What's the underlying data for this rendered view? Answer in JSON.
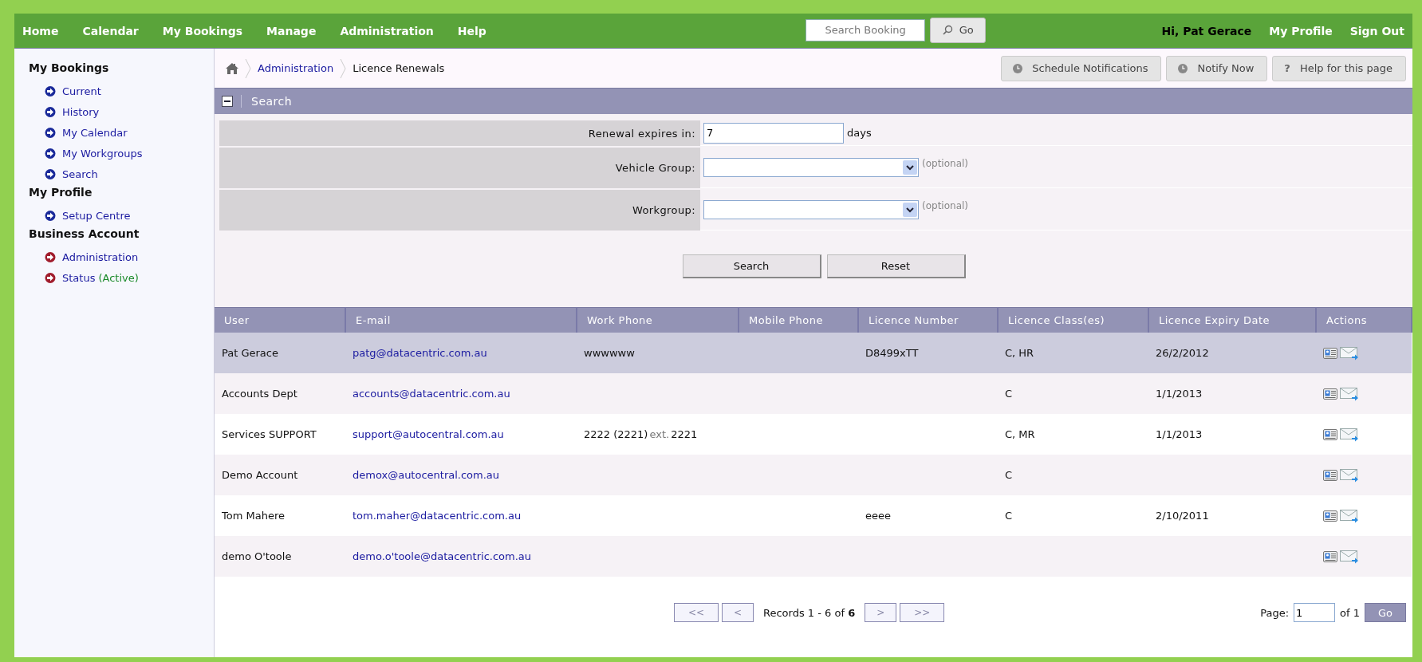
{
  "top_nav": {
    "items": [
      {
        "label": "Home"
      },
      {
        "label": "Calendar"
      },
      {
        "label": "My Bookings"
      },
      {
        "label": "Manage"
      },
      {
        "label": "Administration"
      },
      {
        "label": "Help"
      }
    ],
    "search": {
      "placeholder": "Search Booking",
      "button": "Go"
    },
    "greeting": "Hi, Pat Gerace",
    "links": [
      "My Profile",
      "Sign Out"
    ]
  },
  "sidebar": {
    "sections": [
      {
        "title": "My Bookings",
        "items": [
          {
            "label": "Current",
            "color": "#1a2a9a"
          },
          {
            "label": "History",
            "color": "#1a2a9a"
          },
          {
            "label": "My Calendar",
            "color": "#1a2a9a"
          },
          {
            "label": "My Workgroups",
            "color": "#1a2a9a"
          },
          {
            "label": "Search",
            "color": "#1a2a9a"
          }
        ]
      },
      {
        "title": "My Profile",
        "items": [
          {
            "label": "Setup Centre",
            "color": "#1a2a9a"
          }
        ]
      },
      {
        "title": "Business Account",
        "items": [
          {
            "label": "Administration",
            "color": "#a01c2c"
          },
          {
            "label": "Status",
            "status": "(Active)",
            "color": "#a01c2c"
          }
        ]
      }
    ]
  },
  "breadcrumb": {
    "items": [
      {
        "label": "Administration",
        "link": true
      },
      {
        "label": "Licence Renewals",
        "link": false
      }
    ]
  },
  "toolbar": {
    "buttons": [
      {
        "kind": "clock",
        "label": "Schedule Notifications"
      },
      {
        "kind": "clock",
        "label": "Notify Now"
      },
      {
        "kind": "help",
        "icon": "?",
        "label": "Help for this page"
      }
    ]
  },
  "search_panel": {
    "title": "Search",
    "expanded": true,
    "fields": [
      {
        "kind": "text",
        "label": "Renewal expires in:",
        "value": "7",
        "suffix": "days"
      },
      {
        "kind": "select",
        "label": "Vehicle Group:",
        "suffix": "(optional)"
      },
      {
        "kind": "select",
        "label": "Workgroup:",
        "suffix": "(optional)"
      }
    ],
    "buttons": [
      "Search",
      "Reset"
    ]
  },
  "table": {
    "columns": [
      "User",
      "E-mail",
      "Work Phone",
      "Mobile Phone",
      "Licence Number",
      "Licence Class(es)",
      "Licence Expiry Date",
      "Actions"
    ],
    "rows": [
      {
        "selected": true,
        "user": "Pat Gerace",
        "email": "patg@datacentric.com.au",
        "work_phone": "wwwwww",
        "licence_number": "D8499xTT",
        "classes": "C, HR",
        "expiry": "26/2/2012"
      },
      {
        "selected": false,
        "user": "Accounts Dept",
        "email": "accounts@datacentric.com.au",
        "classes": "C",
        "expiry": "1/1/2013"
      },
      {
        "selected": false,
        "user": "Services SUPPORT",
        "email": "support@autocentral.com.au",
        "work_phone": "2222 (2221)",
        "extension": {
          "label": "ext.",
          "number": "2221"
        },
        "classes": "C, MR",
        "expiry": "1/1/2013"
      },
      {
        "selected": false,
        "user": "Demo Account",
        "email": "demox@autocentral.com.au",
        "classes": "C"
      },
      {
        "selected": false,
        "user": "Tom Mahere",
        "email": "tom.maher@datacentric.com.au",
        "licence_number": "eeee",
        "classes": "C",
        "expiry": "2/10/2011"
      },
      {
        "selected": false,
        "user": "demo O'toole",
        "email": "demo.o'toole@datacentric.com.au"
      }
    ]
  },
  "pager": {
    "first": {
      "label": "<<",
      "disabled": true
    },
    "prev": {
      "label": "<",
      "disabled": true
    },
    "records": "Records 1 - 6 of **6**",
    "next": {
      "label": ">",
      "disabled": true
    },
    "last": {
      "label": ">>",
      "disabled": true
    },
    "page_label": "Page:",
    "page": "1",
    "of": "of 1",
    "go": "Go"
  }
}
